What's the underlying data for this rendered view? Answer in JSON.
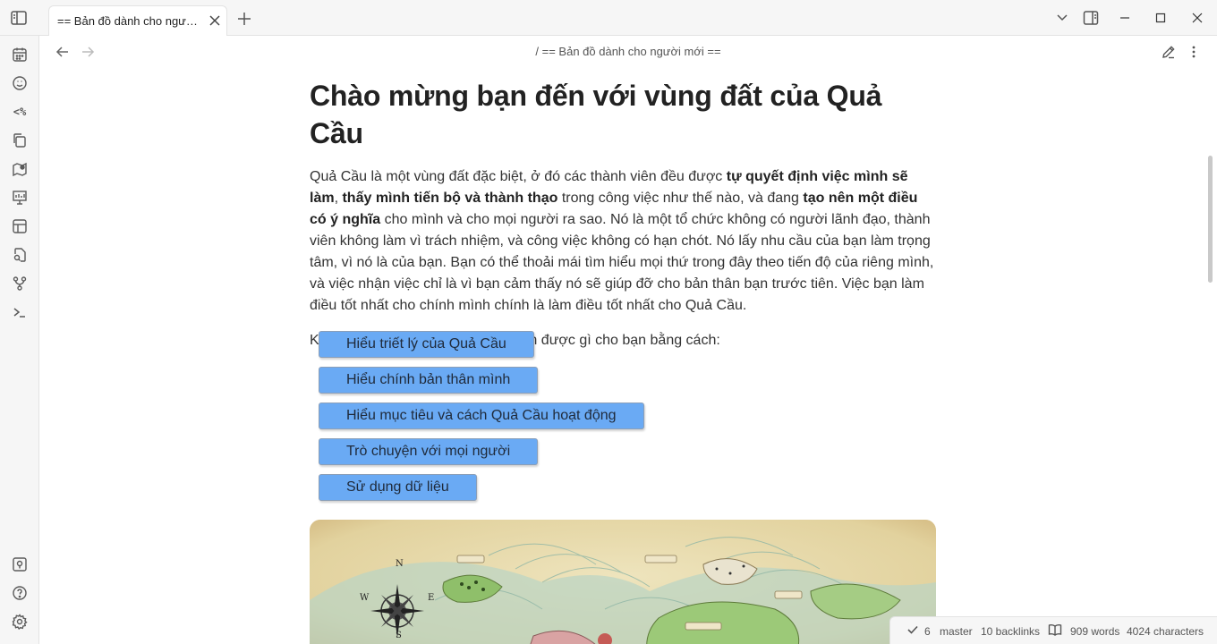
{
  "tab": {
    "title": "== Bản đồ dành cho người mới =="
  },
  "header": {
    "breadcrumb": "/ == Bản đồ dành cho người mới =="
  },
  "ribbon": {
    "top": [
      "calendar-icon",
      "smiley-icon",
      "templater-icon",
      "copy-icon",
      "map-icon",
      "presentation-icon",
      "layout-icon",
      "file-search-icon",
      "git-branch-icon",
      "terminal-icon"
    ],
    "templater_text": "<%",
    "bottom": [
      "vault-icon",
      "help-icon",
      "settings-icon"
    ]
  },
  "content": {
    "title": "Chào mừng bạn đến với vùng đất của Quả Cầu",
    "p1": {
      "a": "Quả Cầu là một vùng đất đặc biệt, ở đó các thành viên đều được ",
      "b1": "tự quyết định việc mình sẽ làm",
      "c": ", ",
      "b2": "thấy mình tiến bộ và thành thạo",
      "d": " trong công việc như thế nào, và đang ",
      "b3": "tạo nên một điều có ý nghĩa",
      "e": " cho mình và cho mọi người ra sao. Nó là một tổ chức không có người lãnh đạo, thành viên không làm vì trách nhiệm, và công việc không có hạn chót. Nó lấy nhu cầu của bạn làm trọng tâm, vì nó là của bạn. Bạn có thể thoải mái tìm hiểu mọi thứ trong đây theo tiến độ của riêng mình, và việc nhận việc chỉ là vì bạn cảm thấy nó sẽ giúp đỡ cho bản thân bạn trước tiên. Việc bạn làm điều tốt nhất cho chính mình chính là làm điều tốt nhất cho Quả Cầu."
    },
    "explore": "Khám phá xem Quả Cầu có thể làm được gì cho bạn bằng cách:",
    "buttons": [
      "Hiểu triết lý của Quả Cầu",
      "Hiểu chính bản thân mình",
      "Hiểu mục tiêu và cách Quả Cầu hoạt động",
      "Trò chuyện với mọi người",
      "Sử dụng dữ liệu"
    ],
    "map_labels": {
      "north": "N",
      "west": "W",
      "east": "E",
      "south": "S"
    }
  },
  "statusbar": {
    "sync_count": "6",
    "branch": "master",
    "backlinks": "10 backlinks",
    "words": "909 words",
    "characters": "4024 characters"
  },
  "colors": {
    "button_bg": "#6aaaf4",
    "chrome_bg": "#f6f6f6"
  }
}
